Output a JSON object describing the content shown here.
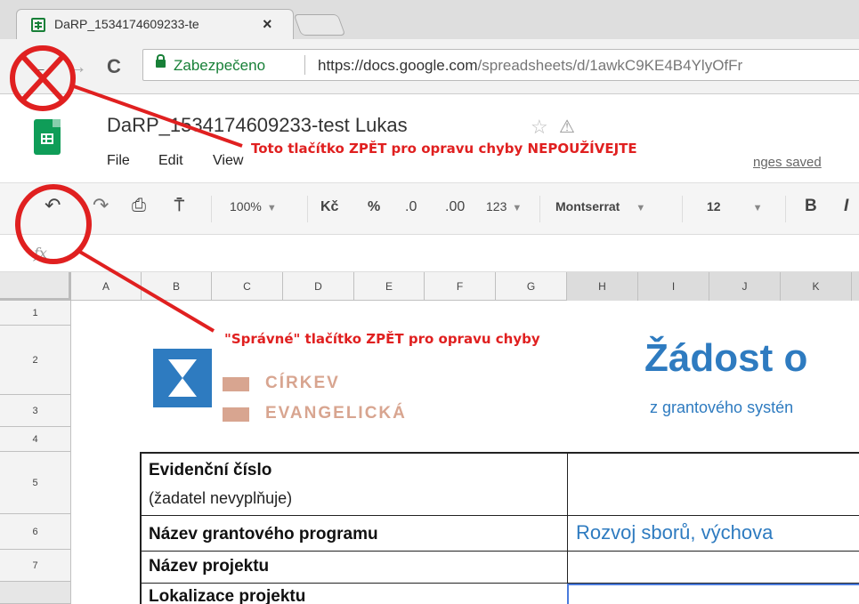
{
  "browser": {
    "tab_title": "DaRP_1534174609233-te",
    "tab_close": "×",
    "secure_label": "Zabezpečeno",
    "url_host": "https://docs.google.com",
    "url_path": "/spreadsheets/d/1awkC9KE4B4YlyOfFr",
    "reload_glyph": "C"
  },
  "sheets": {
    "doc_title": "DaRP_1534174609233-test  Lukas",
    "star_glyph": "☆",
    "drive_glyph": "⚠",
    "menu": [
      "File",
      "Edit",
      "View"
    ],
    "saved_status": "nges saved"
  },
  "toolbar": {
    "zoom": "100%",
    "currency": "Kč",
    "percent": "%",
    "dec_less": ".0",
    "dec_more": ".00",
    "more_formats": "123",
    "font": "Montserrat",
    "font_size": "12",
    "bold": "B",
    "italic": "I"
  },
  "formula": {
    "fx": "fx"
  },
  "grid": {
    "columns": [
      "A",
      "B",
      "C",
      "D",
      "E",
      "F",
      "G",
      "H",
      "I",
      "J",
      "K"
    ],
    "rows": [
      "1",
      "2",
      "3",
      "4",
      "5",
      "6",
      "7"
    ]
  },
  "content": {
    "logo_line1": "CÍRKEV",
    "logo_line2": "EVANGELICKÁ",
    "title": "Žádost o",
    "subtitle": "z grantového systén",
    "form": [
      {
        "label": "Evidenční číslo",
        "sub": "(žadatel nevyplňuje)",
        "value": ""
      },
      {
        "label": "Název grantového programu",
        "sub": "",
        "value": "Rozvoj sborů, výchova"
      },
      {
        "label": "Název projektu",
        "sub": "",
        "value": ""
      },
      {
        "label": "Lokalizace projektu",
        "sub": "",
        "value": ""
      }
    ]
  },
  "annotations": {
    "warning_back": "Toto tlačítko ZPĚT pro opravu chyby NEPOUŽÍVEJTE",
    "correct_undo": "\"Správné\" tlačítko ZPĚT pro opravu chyby",
    "annotation_color": "#e02020"
  }
}
